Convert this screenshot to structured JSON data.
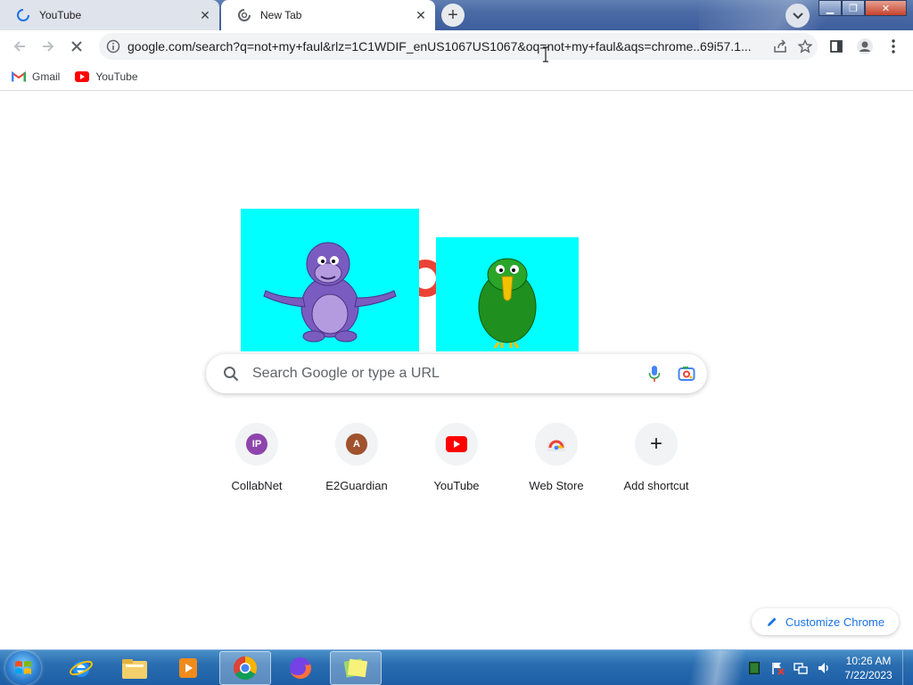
{
  "browser": {
    "tabs": [
      {
        "title": "YouTube",
        "icon": "loading-spinner-icon",
        "active": false
      },
      {
        "title": "New Tab",
        "icon": "loading-spinner-icon",
        "active": true
      }
    ],
    "new_tab_label": "+",
    "url": "google.com/search?q=not+my+faul&rlz=1C1WDIF_enUS1067US1067&oq=not+my+faul&aqs=chrome..69i57.1...",
    "bookmarks": [
      {
        "label": "Gmail",
        "icon": "gmail-icon"
      },
      {
        "label": "YouTube",
        "icon": "youtube-icon"
      }
    ]
  },
  "ntp": {
    "search_placeholder": "Search Google or type a URL",
    "shortcuts": [
      {
        "label": "CollabNet",
        "initial": "IP",
        "color": "#8e44ad"
      },
      {
        "label": "E2Guardian",
        "initial": "A",
        "color": "#a0522d"
      },
      {
        "label": "YouTube",
        "initial": "",
        "color": "#ff0000"
      },
      {
        "label": "Web Store",
        "initial": "",
        "color": "#ffffff"
      },
      {
        "label": "Add shortcut",
        "initial": "+",
        "color": "#f1f3f4"
      }
    ],
    "customize_label": "Customize Chrome",
    "colors": {
      "accent": "#1a73e8",
      "doodle_bg": "#00ffff",
      "ring": "#ea4335"
    }
  },
  "taskbar": {
    "time": "10:26 AM",
    "date": "7/22/2023",
    "items": [
      "internet-explorer-icon",
      "file-explorer-icon",
      "media-player-icon",
      "chrome-icon",
      "firefox-icon",
      "sticky-notes-icon"
    ]
  }
}
